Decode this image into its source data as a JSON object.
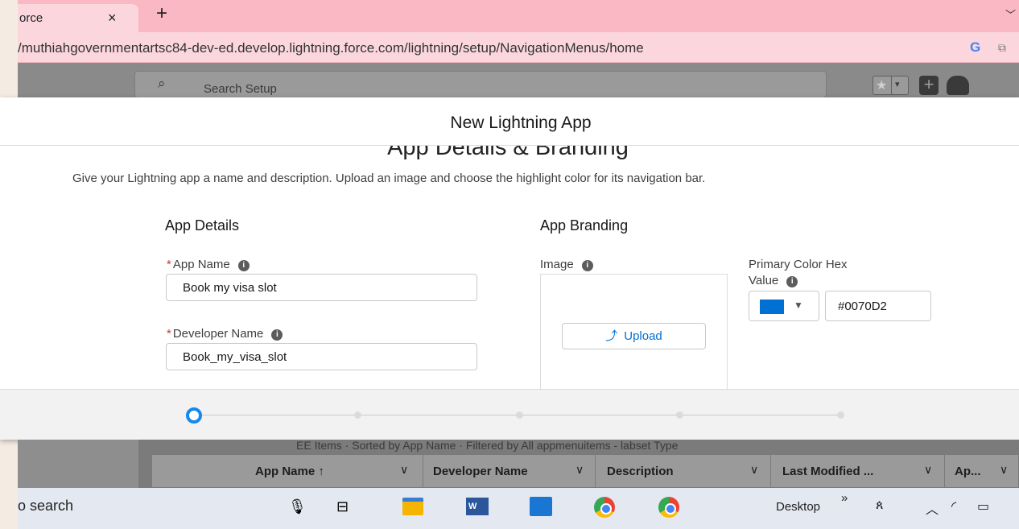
{
  "browser": {
    "tab_title": "orce",
    "tab_close": "×",
    "new_tab": "+",
    "tab_menu": "﹀",
    "url": "/muthiahgovernmentartsc84-dev-ed.develop.lightning.force.com/lightning/setup/NavigationMenus/home",
    "google_icon": "G",
    "extension_icon": "⧉"
  },
  "setup_header": {
    "search_placeholder": "Search Setup",
    "search_icon": "⌕",
    "favorites_icon": "★",
    "favorites_dropdown_icon": "▾",
    "add_icon": "+"
  },
  "modal": {
    "title": "New Lightning App",
    "section_title": "App Details & Branding",
    "section_description": "Give your Lightning app a name and description. Upload an image and choose the highlight color for its navigation bar.",
    "info_glyph": "i",
    "required_mark": "*",
    "app_details": {
      "heading": "App Details",
      "app_name_label": "App Name",
      "app_name_value": "Book my visa slot",
      "developer_name_label": "Developer Name",
      "developer_name_value": "Book_my_visa_slot"
    },
    "app_branding": {
      "heading": "App Branding",
      "image_label": "Image",
      "upload_icon": "⤴",
      "upload_label": "Upload",
      "primary_color_label_line1": "Primary Color Hex",
      "primary_color_label_line2": "Value",
      "color_caret": "▼",
      "primary_color_value": "#0070D2"
    },
    "progress": {
      "current_step": 1,
      "total_steps": 5
    }
  },
  "colors": {
    "primary_color_swatch": "#0070D2",
    "accent": "#1589EE"
  },
  "list_view": {
    "info": "EE Items · Sorted by App Name · Filtered by All appmenuitems - labset Type",
    "columns": [
      {
        "label": "App Name ↑",
        "chev": "∨"
      },
      {
        "label": "Developer Name",
        "chev": "∨"
      },
      {
        "label": "Description",
        "chev": "∨"
      },
      {
        "label": "Last Modified ...",
        "chev": "∨"
      },
      {
        "label": "Ap...",
        "chev": "∨"
      }
    ]
  },
  "taskbar": {
    "search_text": "o search",
    "mic_icon": "🎙",
    "task_view_icon": "⊟",
    "word_label": "W",
    "desktop_label": "Desktop",
    "more_icon": "»",
    "people_icon": "ጰ",
    "tray_chevron": "︿",
    "wifi_icon": "◜",
    "battery_icon": "▭"
  }
}
